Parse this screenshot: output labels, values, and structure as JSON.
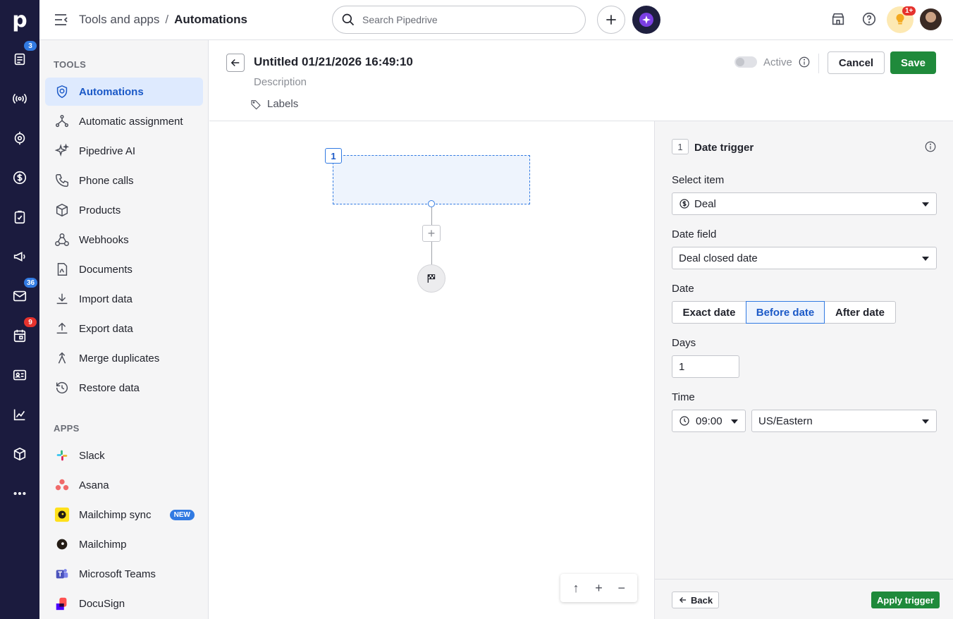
{
  "rail": {
    "logo": "p",
    "badges": {
      "leads": "3",
      "mail": "36",
      "activities": "9"
    }
  },
  "header": {
    "breadcrumb_parent": "Tools and apps",
    "breadcrumb_separator": "/",
    "breadcrumb_current": "Automations",
    "search_placeholder": "Search Pipedrive",
    "tips_badge": "1+"
  },
  "sidebar": {
    "tools_heading": "TOOLS",
    "tools": [
      {
        "label": "Automations",
        "icon": "automations-icon",
        "active": true
      },
      {
        "label": "Automatic assignment",
        "icon": "assignment-icon"
      },
      {
        "label": "Pipedrive AI",
        "icon": "sparkle-icon"
      },
      {
        "label": "Phone calls",
        "icon": "phone-icon"
      },
      {
        "label": "Products",
        "icon": "box-icon"
      },
      {
        "label": "Webhooks",
        "icon": "webhook-icon"
      },
      {
        "label": "Documents",
        "icon": "document-icon"
      },
      {
        "label": "Import data",
        "icon": "download-icon"
      },
      {
        "label": "Export data",
        "icon": "upload-icon"
      },
      {
        "label": "Merge duplicates",
        "icon": "merge-icon"
      },
      {
        "label": "Restore data",
        "icon": "restore-icon"
      }
    ],
    "apps_heading": "APPS",
    "apps": [
      {
        "label": "Slack",
        "icon": "slack-icon"
      },
      {
        "label": "Asana",
        "icon": "asana-icon"
      },
      {
        "label": "Mailchimp sync",
        "icon": "mailchimp-icon",
        "badge": "NEW"
      },
      {
        "label": "Mailchimp",
        "icon": "mailchimp-icon"
      },
      {
        "label": "Microsoft Teams",
        "icon": "teams-icon"
      },
      {
        "label": "DocuSign",
        "icon": "docusign-icon"
      }
    ]
  },
  "automation": {
    "title": "Untitled 01/21/2026 16:49:10",
    "description_placeholder": "Description",
    "labels": "Labels",
    "active_label": "Active",
    "cancel": "Cancel",
    "save": "Save"
  },
  "canvas": {
    "node_number": "1"
  },
  "panel": {
    "step_number": "1",
    "title": "Date trigger",
    "select_item_label": "Select item",
    "select_item_value": "Deal",
    "date_field_label": "Date field",
    "date_field_value": "Deal closed date",
    "date_label": "Date",
    "date_options": [
      "Exact date",
      "Before date",
      "After date"
    ],
    "date_selected": "Before date",
    "days_label": "Days",
    "days_value": "1",
    "time_label": "Time",
    "time_value": "09:00",
    "timezone_value": "US/Eastern",
    "back": "Back",
    "apply": "Apply trigger"
  },
  "colors": {
    "rail": "#1b1b3e",
    "accent": "#317ae2",
    "save": "#1f8a3b"
  }
}
